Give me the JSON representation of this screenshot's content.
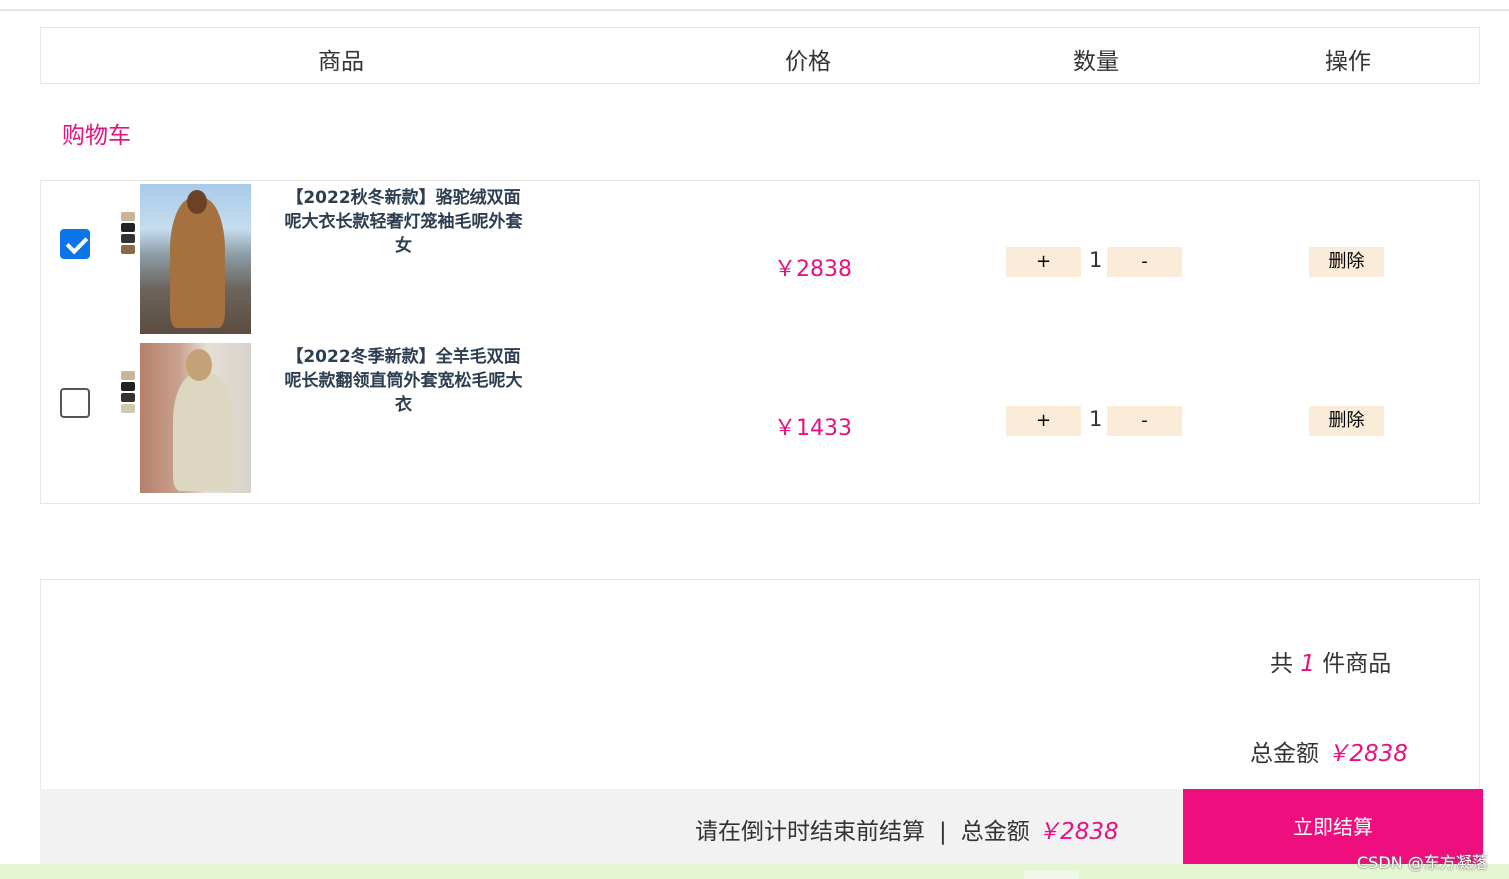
{
  "header": {
    "product": "商品",
    "price": "价格",
    "quantity": "数量",
    "action": "操作"
  },
  "cart_title": "购物车",
  "items": [
    {
      "checked": true,
      "name": "【2022秋冬新款】骆驼绒双面呢大衣长款轻奢灯笼袖毛呢外套女",
      "price": "￥2838",
      "qty": "1",
      "plus": "+",
      "minus": "-",
      "delete": "删除"
    },
    {
      "checked": false,
      "name": "【2022冬季新款】全羊毛双面呢长款翻领直筒外套宽松毛呢大衣",
      "price": "￥1433",
      "qty": "1",
      "plus": "+",
      "minus": "-",
      "delete": "删除"
    }
  ],
  "summary": {
    "count_prefix": "共",
    "count": "1",
    "count_suffix": "件商品",
    "total_label": "总金额",
    "total": "￥2838"
  },
  "footer": {
    "countdown_text": "请在倒计时结束前结算",
    "separator": "|",
    "total_label": "总金额",
    "total": "￥2838",
    "checkout_label": "立即结算"
  },
  "watermark": "CSDN @东方凝落",
  "colors": {
    "accent": "#e4137f",
    "checkout": "#ef0e7e",
    "qty_button_bg": "#fbebd9",
    "checkbox": "#0b74e6"
  }
}
